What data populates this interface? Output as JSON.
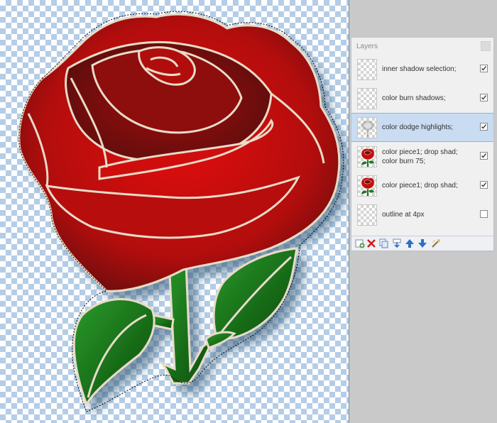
{
  "layers_panel": {
    "title": "Layers",
    "layers": [
      {
        "name": "inner shadow selection;",
        "visible": true,
        "selected": false,
        "thumb": "transparent-thumb"
      },
      {
        "name": "color burn shadows;",
        "visible": true,
        "selected": false,
        "thumb": "transparent-thumb"
      },
      {
        "name": "color dodge highlights;",
        "visible": true,
        "selected": true,
        "thumb": "highlight-thumb"
      },
      {
        "name": "color piece1; drop shad; color burn 75;",
        "visible": true,
        "selected": false,
        "thumb": "rose-thumb"
      },
      {
        "name": "color piece1; drop shad;",
        "visible": true,
        "selected": false,
        "thumb": "rose-thumb"
      },
      {
        "name": "outline at 4px",
        "visible": false,
        "selected": false,
        "thumb": "transparent-thumb"
      }
    ],
    "toolbar": [
      {
        "name": "add-layer-icon",
        "color": "#4a9a3a"
      },
      {
        "name": "delete-layer-icon",
        "color": "#cc2020"
      },
      {
        "name": "duplicate-layer-icon",
        "color": "#5a86c2"
      },
      {
        "name": "merge-down-icon",
        "color": "#2d6fc7"
      },
      {
        "name": "move-layer-up-icon",
        "color": "#2d6fc7"
      },
      {
        "name": "move-layer-down-icon",
        "color": "#2d6fc7"
      },
      {
        "name": "layer-properties-icon",
        "color": "#8c6d3a"
      }
    ]
  },
  "colors": {
    "rose_red": "#c40d0d",
    "rose_dark": "#7a0a0a",
    "leaf_green": "#1e7a1e",
    "leaf_dark": "#0d4a0d",
    "outline": "#e8dcc8",
    "selection_bg": "#c9dcf1"
  }
}
